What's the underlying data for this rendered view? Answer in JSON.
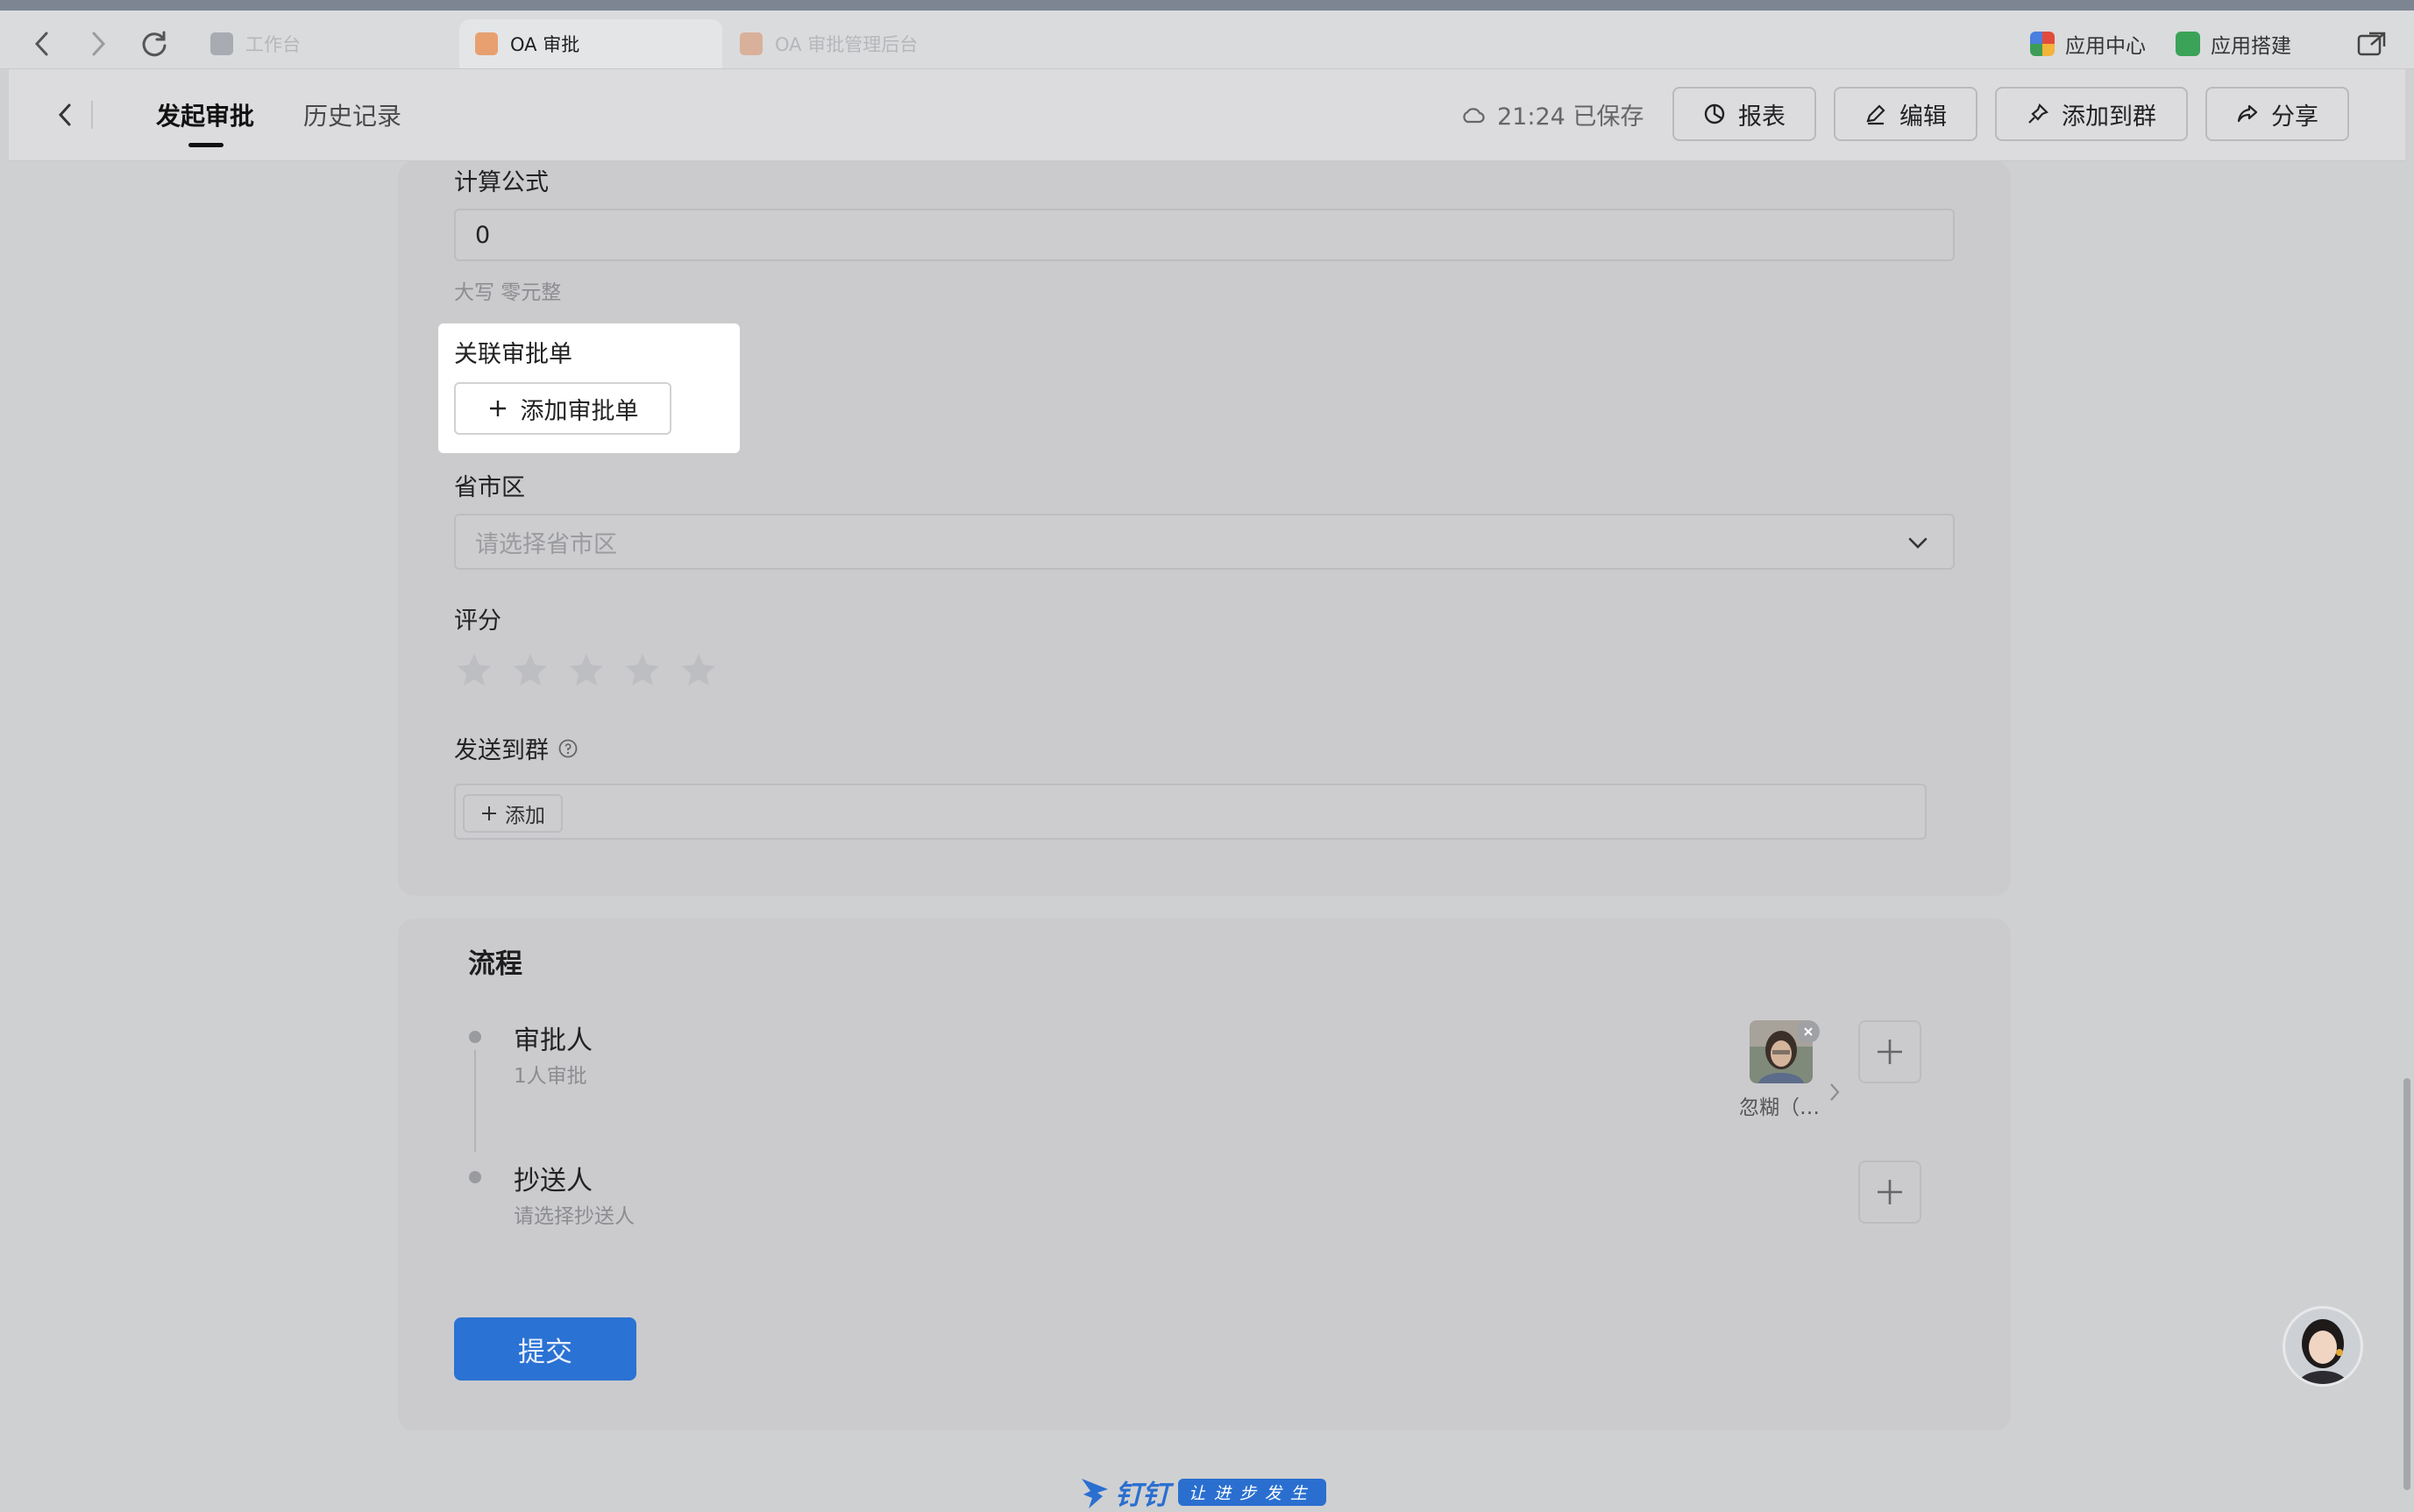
{
  "tabs": [
    {
      "label": "工作台",
      "icon": "org-icon",
      "state": "inactive"
    },
    {
      "label": "OA 审批",
      "icon": "oa-approval-icon",
      "state": "active"
    },
    {
      "label": "OA 审批管理后台",
      "icon": "oa-approval-icon",
      "state": "inactive"
    }
  ],
  "titlebar_right": {
    "app_center": "应用中心",
    "app_builder": "应用搭建"
  },
  "toolbar": {
    "tab_initiate": "发起审批",
    "tab_history": "历史记录",
    "saved_status": "21:24 已保存",
    "report_label": "报表",
    "edit_label": "编辑",
    "add_group_label": "添加到群",
    "share_label": "分享"
  },
  "form": {
    "formula_label": "计算公式",
    "formula_value": "0",
    "formula_caps": "大写 零元整",
    "related_label": "关联审批单",
    "related_button": "添加审批单",
    "region_label": "省市区",
    "region_placeholder": "请选择省市区",
    "rating_label": "评分",
    "rating_value": 0,
    "rating_max": 5,
    "send_group_label": "发送到群",
    "send_group_add": "添加"
  },
  "process": {
    "title": "流程",
    "approver_title": "审批人",
    "approver_sub": "1人审批",
    "approver_name": "忽糊（…",
    "cc_title": "抄送人",
    "cc_sub": "请选择抄送人"
  },
  "submit_label": "提交",
  "footer": {
    "brand": "钉钉",
    "slogan": "让进步发生"
  },
  "colors": {
    "primary": "#2a72d3",
    "brand": "#2a6fd0"
  }
}
